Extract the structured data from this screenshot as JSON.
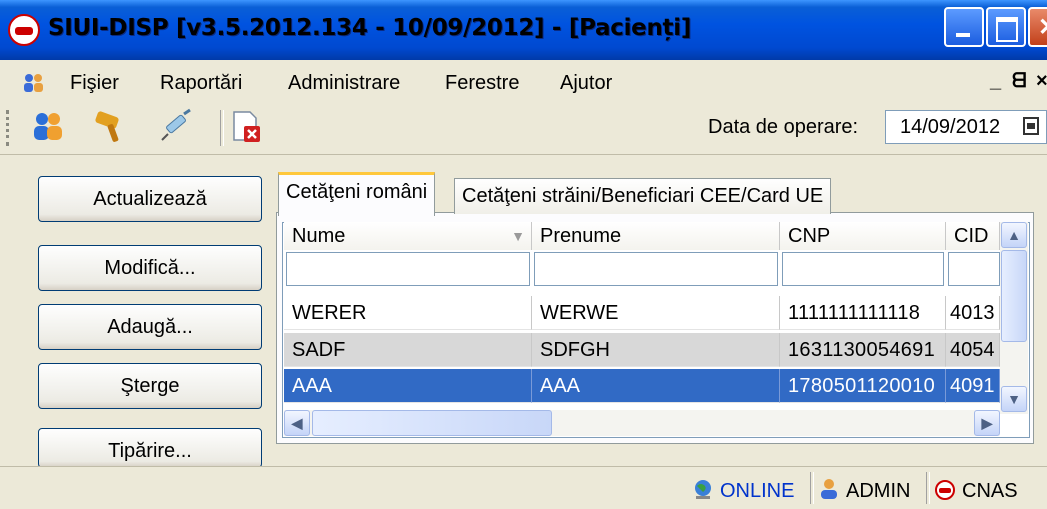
{
  "window": {
    "title": "SIUI-DISP [v3.5.2012.134 - 10/09/2012] - [Pacienți]"
  },
  "menu": {
    "items": [
      "Fişier",
      "Raportări",
      "Administrare",
      "Ferestre",
      "Ajutor"
    ],
    "mdi_controls": [
      "_",
      "ᗺ",
      "×"
    ]
  },
  "toolbar": {
    "icons": [
      "users-icon",
      "gavel-icon",
      "syringe-icon",
      "document-close-icon"
    ],
    "date_label": "Data de operare:",
    "date_value": "14/09/2012"
  },
  "actions": [
    "Actualizează",
    "Modifică...",
    "Adaugă...",
    "Şterge",
    "Tipărire..."
  ],
  "tabs": [
    "Cetăţeni români",
    "Cetăţeni străini/Beneficiari CEE/Card UE"
  ],
  "grid": {
    "columns": [
      "Nume",
      "Prenume",
      "CNP",
      "CID"
    ],
    "rows": [
      {
        "nume": "WERER",
        "prenume": "WERWE",
        "cnp": "1111111111118",
        "cid": "4013"
      },
      {
        "nume": "SADF",
        "prenume": "SDFGH",
        "cnp": "1631130054691",
        "cid": "4054"
      },
      {
        "nume": "AAA",
        "prenume": "AAA",
        "cnp": "1780501120010",
        "cid": "4091"
      }
    ]
  },
  "status": {
    "connection": "ONLINE",
    "user": "ADMIN",
    "org": "CNAS"
  },
  "colors": {
    "titlebar": "#0053e0",
    "selection": "#316ac5",
    "status_link": "#0033cc"
  }
}
